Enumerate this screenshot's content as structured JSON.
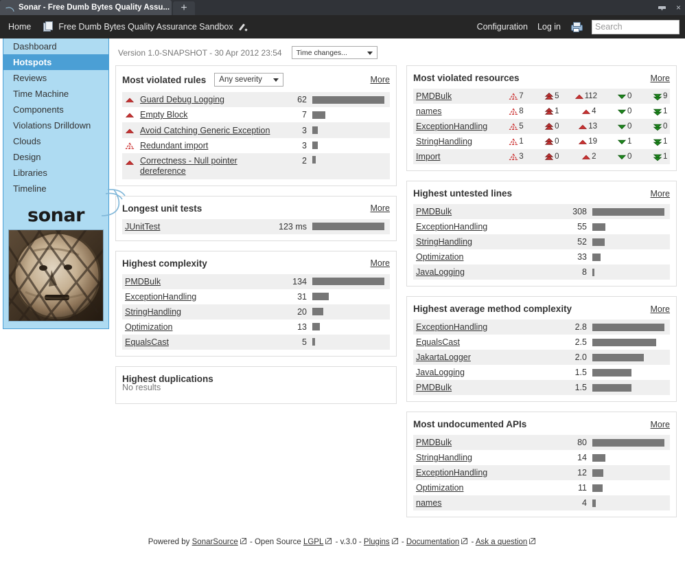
{
  "browser": {
    "tab_title": "Sonar - Free Dumb Bytes Quality Assu...",
    "new_tab_label": "+",
    "minimize_label": "",
    "close_label": "×"
  },
  "header": {
    "home_label": "Home",
    "project_name": "Free Dumb Bytes Quality Assurance Sandbox",
    "configuration_label": "Configuration",
    "login_label": "Log in",
    "search_placeholder": "Search",
    "search_value": ""
  },
  "sidebar": {
    "items": [
      {
        "label": "Dashboard",
        "selected": false
      },
      {
        "label": "Hotspots",
        "selected": true
      },
      {
        "label": "Reviews",
        "selected": false
      },
      {
        "label": "Time Machine",
        "selected": false
      },
      {
        "label": "Components",
        "selected": false
      },
      {
        "label": "Violations Drilldown",
        "selected": false
      },
      {
        "label": "Clouds",
        "selected": false
      },
      {
        "label": "Design",
        "selected": false
      },
      {
        "label": "Libraries",
        "selected": false
      },
      {
        "label": "Timeline",
        "selected": false
      }
    ],
    "logo_text": "sonar"
  },
  "version_bar": {
    "version_text": "Version 1.0-SNAPSHOT - 30 Apr 2012 23:54",
    "time_changes_label": "Time changes..."
  },
  "widgets": {
    "most_violated_rules": {
      "title": "Most violated rules",
      "severity_filter": "Any severity",
      "more_label": "More",
      "rows": [
        {
          "severity": "major",
          "name": "Guard Debug Logging",
          "value": "62",
          "bar_pct": 100
        },
        {
          "severity": "major",
          "name": "Empty Block",
          "value": "7",
          "bar_pct": 18
        },
        {
          "severity": "major",
          "name": "Avoid Catching Generic Exception",
          "value": "3",
          "bar_pct": 8
        },
        {
          "severity": "blocker",
          "name": "Redundant import",
          "value": "3",
          "bar_pct": 8
        },
        {
          "severity": "major",
          "name": "Correctness - Null pointer dereference",
          "value": "2",
          "bar_pct": 5
        }
      ]
    },
    "longest_unit_tests": {
      "title": "Longest unit tests",
      "more_label": "More",
      "rows": [
        {
          "name": "JUnitTest",
          "value": "123 ms",
          "bar_pct": 100
        }
      ]
    },
    "highest_complexity": {
      "title": "Highest complexity",
      "more_label": "More",
      "rows": [
        {
          "name": "PMDBulk",
          "value": "134",
          "bar_pct": 100
        },
        {
          "name": "ExceptionHandling",
          "value": "31",
          "bar_pct": 23
        },
        {
          "name": "StringHandling",
          "value": "20",
          "bar_pct": 15
        },
        {
          "name": "Optimization",
          "value": "13",
          "bar_pct": 10
        },
        {
          "name": "EqualsCast",
          "value": "5",
          "bar_pct": 4
        }
      ]
    },
    "highest_duplications": {
      "title": "Highest duplications",
      "empty_label": "No results"
    },
    "most_violated_resources": {
      "title": "Most violated resources",
      "more_label": "More",
      "rows": [
        {
          "name": "PMDBulk",
          "blocker": "7",
          "critical": "5",
          "major": "112",
          "minor": "0",
          "info": "9"
        },
        {
          "name": "names",
          "blocker": "8",
          "critical": "1",
          "major": "4",
          "minor": "0",
          "info": "1"
        },
        {
          "name": "ExceptionHandling",
          "blocker": "5",
          "critical": "0",
          "major": "13",
          "minor": "0",
          "info": "0"
        },
        {
          "name": "StringHandling",
          "blocker": "1",
          "critical": "0",
          "major": "19",
          "minor": "1",
          "info": "1"
        },
        {
          "name": "Import",
          "blocker": "3",
          "critical": "0",
          "major": "2",
          "minor": "0",
          "info": "1"
        }
      ]
    },
    "highest_untested_lines": {
      "title": "Highest untested lines",
      "more_label": "More",
      "rows": [
        {
          "name": "PMDBulk",
          "value": "308",
          "bar_pct": 100
        },
        {
          "name": "ExceptionHandling",
          "value": "55",
          "bar_pct": 18
        },
        {
          "name": "StringHandling",
          "value": "52",
          "bar_pct": 17
        },
        {
          "name": "Optimization",
          "value": "33",
          "bar_pct": 11
        },
        {
          "name": "JavaLogging",
          "value": "8",
          "bar_pct": 3
        }
      ]
    },
    "highest_average_method_complexity": {
      "title": "Highest average method complexity",
      "more_label": "More",
      "rows": [
        {
          "name": "ExceptionHandling",
          "value": "2.8",
          "bar_pct": 100
        },
        {
          "name": "EqualsCast",
          "value": "2.5",
          "bar_pct": 89
        },
        {
          "name": "JakartaLogger",
          "value": "2.0",
          "bar_pct": 71
        },
        {
          "name": "JavaLogging",
          "value": "1.5",
          "bar_pct": 54
        },
        {
          "name": "PMDBulk",
          "value": "1.5",
          "bar_pct": 54
        }
      ]
    },
    "most_undocumented_apis": {
      "title": "Most undocumented APIs",
      "more_label": "More",
      "rows": [
        {
          "name": "PMDBulk",
          "value": "80",
          "bar_pct": 100
        },
        {
          "name": "StringHandling",
          "value": "14",
          "bar_pct": 18
        },
        {
          "name": "ExceptionHandling",
          "value": "12",
          "bar_pct": 15
        },
        {
          "name": "Optimization",
          "value": "11",
          "bar_pct": 14
        },
        {
          "name": "names",
          "value": "4",
          "bar_pct": 5
        }
      ]
    }
  },
  "footer": {
    "powered_by": "Powered by",
    "sonarsource": "SonarSource",
    "open_source": "- Open Source",
    "lgpl": "LGPL",
    "version": "- v.3.0 -",
    "plugins": "Plugins",
    "dash1": "-",
    "documentation": "Documentation",
    "dash2": "-",
    "ask": "Ask a question"
  },
  "colors": {
    "accent_blue": "#4b9fd5",
    "sidebar_bg": "#aedbf2",
    "bar_gray": "#777777",
    "severity_red": "#cc3333",
    "severity_green": "#1e8a1e",
    "row_odd": "#efefef"
  }
}
